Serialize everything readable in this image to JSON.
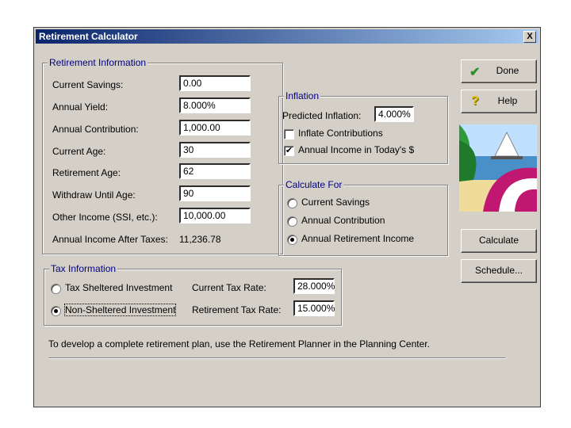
{
  "window": {
    "title": "Retirement Calculator",
    "close_glyph": "X"
  },
  "retirement_info": {
    "legend": "Retirement Information",
    "rows": [
      {
        "label": "Current Savings:",
        "value": "0.00"
      },
      {
        "label": "Annual Yield:",
        "value": "8.000%"
      },
      {
        "label": "Annual Contribution:",
        "value": "1,000.00"
      },
      {
        "label": "Current Age:",
        "value": "30"
      },
      {
        "label": "Retirement Age:",
        "value": "62"
      },
      {
        "label": "Withdraw Until Age:",
        "value": "90"
      },
      {
        "label": "Other Income (SSI, etc.):",
        "value": "10,000.00"
      }
    ],
    "after_taxes_label": "Annual Income After Taxes:",
    "after_taxes_value": "11,236.78"
  },
  "inflation": {
    "legend": "Inflation",
    "predicted_label": "Predicted Inflation:",
    "predicted_value": "4.000%",
    "inflate_contrib_label": "Inflate Contributions",
    "inflate_contrib_checked": false,
    "todays_dollars_label": "Annual Income in Today's $",
    "todays_dollars_checked": true,
    "check_glyph": "✔"
  },
  "calculate_for": {
    "legend": "Calculate For",
    "options": [
      "Current Savings",
      "Annual Contribution",
      "Annual Retirement Income"
    ],
    "selected_index": 2
  },
  "tax_info": {
    "legend": "Tax Information",
    "options": [
      "Tax Sheltered Investment",
      "Non-Sheltered Investment"
    ],
    "selected_index": 1,
    "current_rate_label": "Current Tax Rate:",
    "current_rate_value": "28.000%",
    "retirement_rate_label": "Retirement Tax Rate:",
    "retirement_rate_value": "15.000%"
  },
  "buttons": {
    "done": "Done",
    "help": "Help",
    "calculate": "Calculate",
    "schedule": "Schedule..."
  },
  "icons": {
    "done": "checkmark-icon",
    "help": "question-icon",
    "picture": "beach-umbrella-image"
  },
  "colors": {
    "title_bar": "#0a246a",
    "legend_text": "#000080",
    "face": "#d4d0c8",
    "done_check": "#2e8b2e",
    "help_q": "#e0c000"
  },
  "footer_note": "To develop a complete retirement plan, use the Retirement Planner in the Planning Center."
}
